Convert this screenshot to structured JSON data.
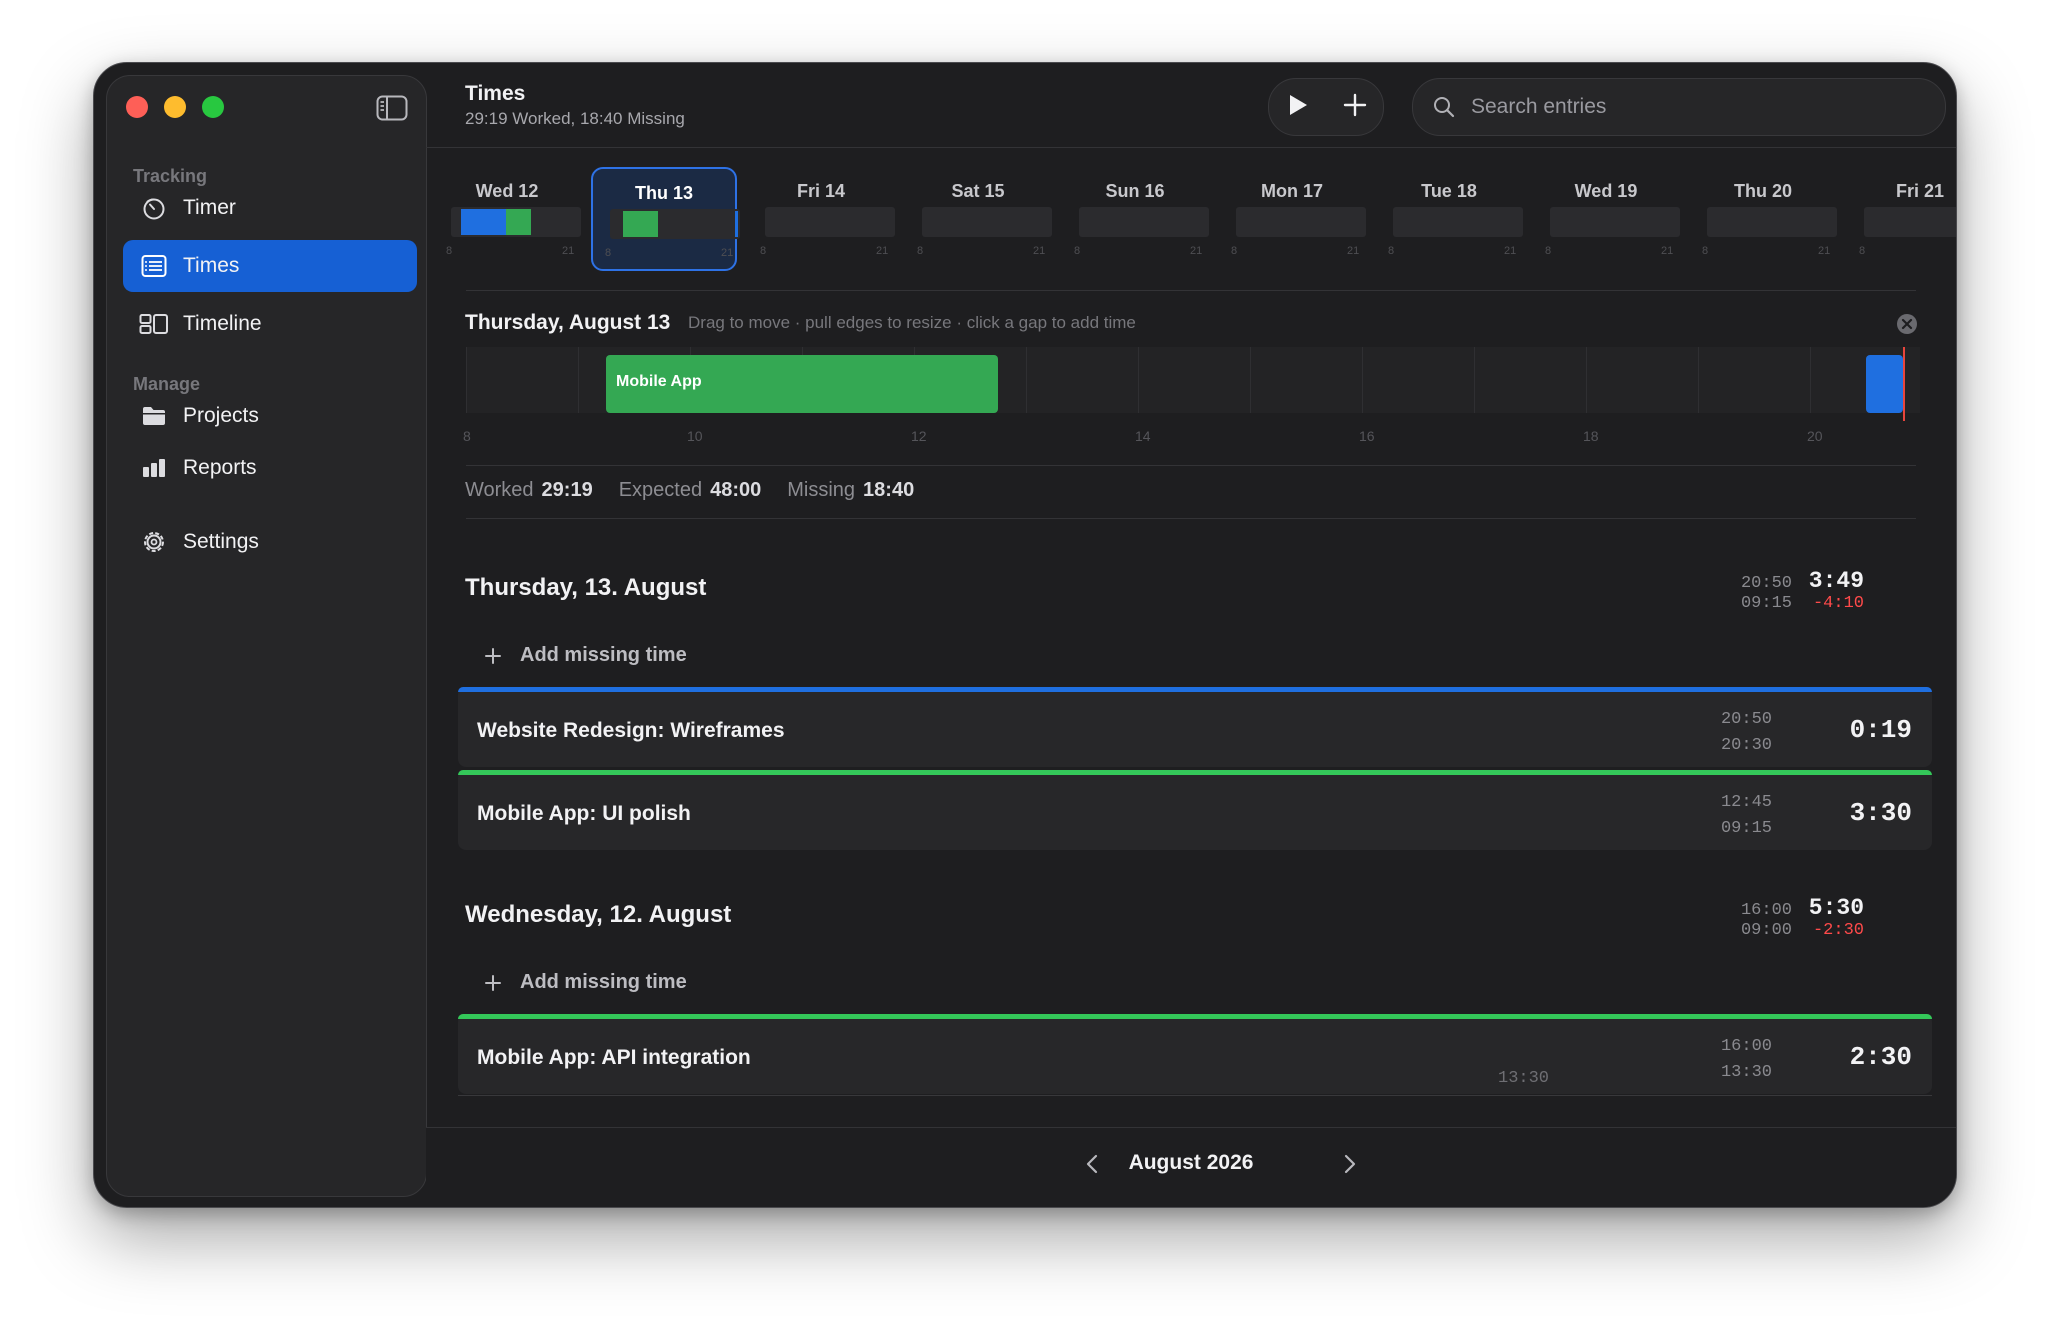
{
  "header": {
    "title": "Times",
    "subtitle": "29:19 Worked, 18:40 Missing",
    "search_placeholder": "Search entries"
  },
  "sidebar": {
    "sections": [
      {
        "label": "Tracking",
        "items": [
          {
            "label": "Timer",
            "icon": "timer-icon"
          },
          {
            "label": "Times",
            "icon": "list-icon",
            "active": true
          },
          {
            "label": "Timeline",
            "icon": "timeline-icon"
          }
        ]
      },
      {
        "label": "Manage",
        "items": [
          {
            "label": "Projects",
            "icon": "folder-icon"
          },
          {
            "label": "Reports",
            "icon": "bar-chart-icon"
          }
        ]
      }
    ],
    "settings_label": "Settings"
  },
  "day_strip": {
    "days": [
      {
        "label": "Wed 12",
        "segments": [
          {
            "start": 9.0,
            "end": 16.0,
            "color": "#1f6fe0"
          },
          {
            "start": 13.5,
            "end": 16.0,
            "color": "#34a853"
          }
        ]
      },
      {
        "label": "Thu 13",
        "selected": true,
        "segments": [
          {
            "start": 9.25,
            "end": 12.75,
            "color": "#34a853"
          },
          {
            "start": 20.5,
            "end": 20.83,
            "color": "#1f6fe0"
          }
        ]
      },
      {
        "label": "Fri 14",
        "segments": []
      },
      {
        "label": "Sat 15",
        "segments": []
      },
      {
        "label": "Sun 16",
        "segments": []
      },
      {
        "label": "Mon 17",
        "segments": []
      },
      {
        "label": "Tue 18",
        "segments": []
      },
      {
        "label": "Wed 19",
        "segments": []
      },
      {
        "label": "Thu 20",
        "segments": []
      },
      {
        "label": "Fri 21",
        "segments": []
      }
    ],
    "tick_start": "8",
    "tick_end": "21"
  },
  "day_detail": {
    "title": "Thursday, August 13",
    "hint": "Drag to move · pull edges to resize · click a gap to add time",
    "ticks": [
      "8",
      "10",
      "12",
      "14",
      "16",
      "18",
      "20"
    ],
    "blocks": [
      {
        "label": "Mobile App",
        "start": 9.25,
        "end": 12.75,
        "color": "#34a853"
      },
      {
        "label": "",
        "start": 20.5,
        "end": 20.83,
        "color": "#1f6fe0"
      }
    ],
    "now_hour": 20.83
  },
  "stats": {
    "worked_label": "Worked",
    "worked": "29:19",
    "expected_label": "Expected",
    "expected": "48:00",
    "missing_label": "Missing",
    "missing": "18:40"
  },
  "days": [
    {
      "heading": "Thursday, 13. August",
      "end": "20:50",
      "start": "09:15",
      "total": "3:49",
      "deficit": "-4:10",
      "add_missing_label": "Add missing time",
      "entries": [
        {
          "name": "Website Redesign: Wireframes",
          "end": "20:50",
          "start": "20:30",
          "duration": "0:19",
          "color": "#1f6fe0"
        },
        {
          "name": "Mobile App: UI polish",
          "end": "12:45",
          "start": "09:15",
          "duration": "3:30",
          "color": "#34c759"
        }
      ]
    },
    {
      "heading": "Wednesday, 12. August",
      "end": "16:00",
      "start": "09:00",
      "total": "5:30",
      "deficit": "-2:30",
      "add_missing_label": "Add missing time",
      "entries": [
        {
          "name": "Mobile App: API integration",
          "end": "16:00",
          "start": "13:30",
          "duration": "2:30",
          "color": "#34c759"
        }
      ]
    }
  ],
  "partial_entry_time": "13:30",
  "footer": {
    "month": "August 2026"
  }
}
